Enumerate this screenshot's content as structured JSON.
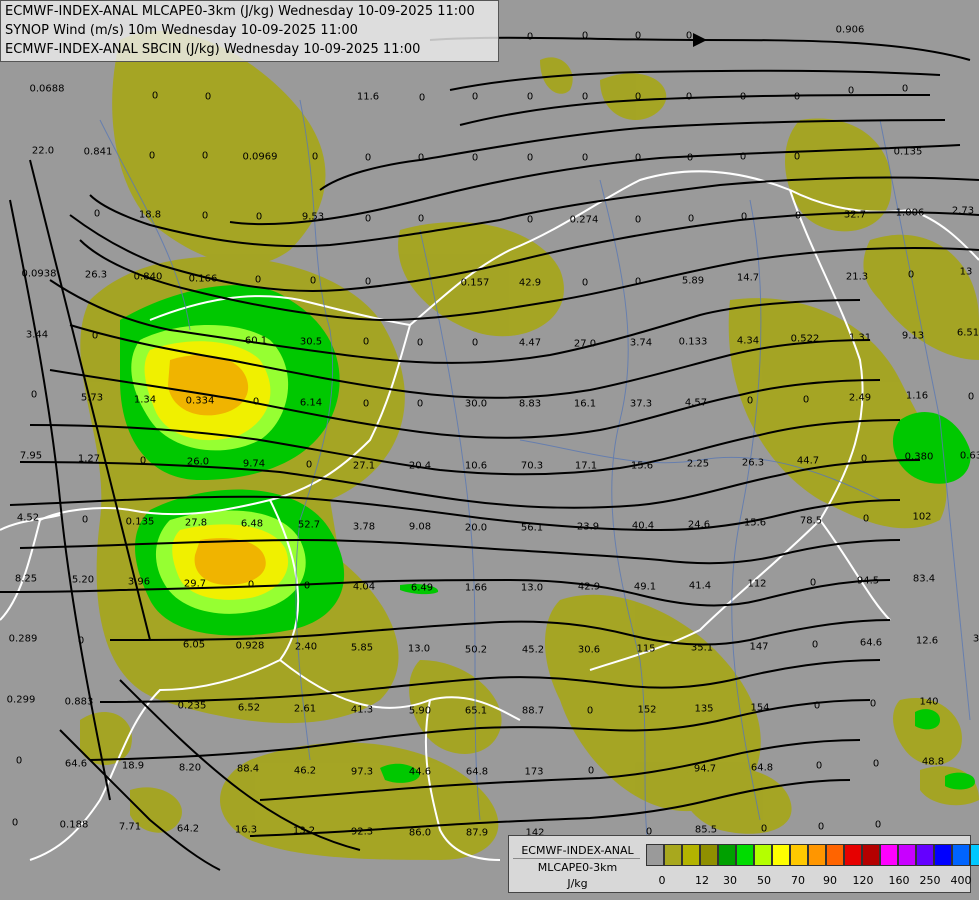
{
  "title_lines": [
    "ECMWF-INDEX-ANAL MLCAPE0-3km (J/kg) Wednesday 10-09-2025 11:00",
    "SYNOP Wind (m/s) 10m Wednesday 10-09-2025 11:00",
    "ECMWF-INDEX-ANAL SBCIN (J/kg) Wednesday 10-09-2025 11:00"
  ],
  "legend": {
    "name": "ECMWF-INDEX-ANAL",
    "sub": "MLCAPE0-3km",
    "unit": "J/kg",
    "colors": [
      "#9a9a9a",
      "#a8a81e",
      "#b3b300",
      "#8f8f00",
      "#00a000",
      "#00dc00",
      "#b4ff00",
      "#ffff00",
      "#ffc800",
      "#ff9600",
      "#ff6400",
      "#e60000",
      "#b40000",
      "#ff00ff",
      "#c800ff",
      "#6400ff",
      "#0000ff",
      "#0064ff",
      "#00c8ff",
      "#64ffff",
      "#ffffff"
    ],
    "ticks": [
      "0",
      "12",
      "30",
      "50",
      "70",
      "90",
      "120",
      "160",
      "250",
      "400"
    ]
  },
  "cin_values": [
    {
      "v": "0.0688"
    },
    {
      "v": "0"
    },
    {
      "v": "0"
    },
    {
      "v": "11.6"
    },
    {
      "v": "0"
    },
    {
      "v": "0"
    },
    {
      "v": "0"
    },
    {
      "v": "0"
    },
    {
      "v": "0"
    },
    {
      "v": "0"
    },
    {
      "v": "0"
    },
    {
      "v": "0"
    },
    {
      "v": "0"
    },
    {
      "v": "0"
    },
    {
      "v": "22.0"
    },
    {
      "v": "0.841"
    },
    {
      "v": "0"
    },
    {
      "v": "0"
    },
    {
      "v": "0.0969"
    },
    {
      "v": "0"
    },
    {
      "v": "0"
    },
    {
      "v": "0"
    },
    {
      "v": "0"
    },
    {
      "v": "0"
    },
    {
      "v": "0"
    },
    {
      "v": "0"
    },
    {
      "v": "0"
    },
    {
      "v": "0"
    },
    {
      "v": "0"
    },
    {
      "v": "0.135"
    },
    {
      "v": "0"
    },
    {
      "v": "18.8"
    },
    {
      "v": "0"
    },
    {
      "v": "0"
    },
    {
      "v": "9.53"
    },
    {
      "v": "0"
    },
    {
      "v": "0"
    },
    {
      "v": "0"
    },
    {
      "v": "0.274"
    },
    {
      "v": "0"
    },
    {
      "v": "0"
    },
    {
      "v": "0"
    },
    {
      "v": "0"
    },
    {
      "v": "32.7"
    },
    {
      "v": "1.006"
    },
    {
      "v": "2.73"
    },
    {
      "v": "0.0938"
    },
    {
      "v": "26.3"
    },
    {
      "v": "0.840"
    },
    {
      "v": "0.166"
    },
    {
      "v": "0"
    },
    {
      "v": "0"
    },
    {
      "v": "0"
    },
    {
      "v": "0.157"
    },
    {
      "v": "42.9"
    },
    {
      "v": "0"
    },
    {
      "v": "0"
    },
    {
      "v": "5.89"
    },
    {
      "v": "14.7"
    },
    {
      "v": "21.3"
    },
    {
      "v": "0"
    },
    {
      "v": "13"
    },
    {
      "v": "3.44"
    },
    {
      "v": "0"
    },
    {
      "v": "60.1"
    },
    {
      "v": "30.5"
    },
    {
      "v": "0"
    },
    {
      "v": "0"
    },
    {
      "v": "0"
    },
    {
      "v": "4.47"
    },
    {
      "v": "27.0"
    },
    {
      "v": "3.74"
    },
    {
      "v": "0.133"
    },
    {
      "v": "4.34"
    },
    {
      "v": "0.522"
    },
    {
      "v": "1.31"
    },
    {
      "v": "9.13"
    },
    {
      "v": "6.51"
    },
    {
      "v": "0"
    },
    {
      "v": "5.73"
    },
    {
      "v": "1.34"
    },
    {
      "v": "0.334"
    },
    {
      "v": "0"
    },
    {
      "v": "6.14"
    },
    {
      "v": "0"
    },
    {
      "v": "0"
    },
    {
      "v": "30.0"
    },
    {
      "v": "8.83"
    },
    {
      "v": "16.1"
    },
    {
      "v": "37.3"
    },
    {
      "v": "4.57"
    },
    {
      "v": "0"
    },
    {
      "v": "0"
    },
    {
      "v": "2.49"
    },
    {
      "v": "1.16"
    },
    {
      "v": "0"
    },
    {
      "v": "7.95"
    },
    {
      "v": "1.27"
    },
    {
      "v": "0"
    },
    {
      "v": "26.0"
    },
    {
      "v": "9.74"
    },
    {
      "v": "0"
    },
    {
      "v": "27.1"
    },
    {
      "v": "20.4"
    },
    {
      "v": "10.6"
    },
    {
      "v": "70.3"
    },
    {
      "v": "17.1"
    },
    {
      "v": "15.6"
    },
    {
      "v": "2.25"
    },
    {
      "v": "26.3"
    },
    {
      "v": "44.7"
    },
    {
      "v": "0"
    },
    {
      "v": "0.380"
    },
    {
      "v": "0.63"
    },
    {
      "v": "4.52"
    },
    {
      "v": "0"
    },
    {
      "v": "0.135"
    },
    {
      "v": "27.8"
    },
    {
      "v": "6.48"
    },
    {
      "v": "52.7"
    },
    {
      "v": "3.78"
    },
    {
      "v": "9.08"
    },
    {
      "v": "20.0"
    },
    {
      "v": "56.1"
    },
    {
      "v": "23.9"
    },
    {
      "v": "40.4"
    },
    {
      "v": "24.6"
    },
    {
      "v": "15.6"
    },
    {
      "v": "78.5"
    },
    {
      "v": "0"
    },
    {
      "v": "102"
    },
    {
      "v": "8.25"
    },
    {
      "v": "5.20"
    },
    {
      "v": "3.96"
    },
    {
      "v": "29.7"
    },
    {
      "v": "0"
    },
    {
      "v": "0"
    },
    {
      "v": "4.04"
    },
    {
      "v": "6.49"
    },
    {
      "v": "1.66"
    },
    {
      "v": "13.0"
    },
    {
      "v": "42.9"
    },
    {
      "v": "49.1"
    },
    {
      "v": "41.4"
    },
    {
      "v": "112"
    },
    {
      "v": "0"
    },
    {
      "v": "94.5"
    },
    {
      "v": "83.4"
    },
    {
      "v": "0.289"
    },
    {
      "v": "0"
    },
    {
      "v": "6.05"
    },
    {
      "v": "0.928"
    },
    {
      "v": "2.40"
    },
    {
      "v": "5.85"
    },
    {
      "v": "13.0"
    },
    {
      "v": "50.2"
    },
    {
      "v": "45.2"
    },
    {
      "v": "30.6"
    },
    {
      "v": "115"
    },
    {
      "v": "35.1"
    },
    {
      "v": "147"
    },
    {
      "v": "0"
    },
    {
      "v": "64.6"
    },
    {
      "v": "12.6"
    },
    {
      "v": "3"
    },
    {
      "v": "0.299"
    },
    {
      "v": "0.883"
    },
    {
      "v": "0.235"
    },
    {
      "v": "6.52"
    },
    {
      "v": "2.61"
    },
    {
      "v": "41.3"
    },
    {
      "v": "5.90"
    },
    {
      "v": "65.1"
    },
    {
      "v": "88.7"
    },
    {
      "v": "0"
    },
    {
      "v": "152"
    },
    {
      "v": "135"
    },
    {
      "v": "154"
    },
    {
      "v": "0"
    },
    {
      "v": "0"
    },
    {
      "v": "140"
    },
    {
      "v": "0"
    },
    {
      "v": "64.6"
    },
    {
      "v": "18.9"
    },
    {
      "v": "8.20"
    },
    {
      "v": "88.4"
    },
    {
      "v": "46.2"
    },
    {
      "v": "97.3"
    },
    {
      "v": "44.6"
    },
    {
      "v": "64.8"
    },
    {
      "v": "173"
    },
    {
      "v": "0"
    },
    {
      "v": "94.7"
    },
    {
      "v": "64.8"
    },
    {
      "v": "0"
    },
    {
      "v": "0"
    },
    {
      "v": "48.8"
    },
    {
      "v": "0"
    },
    {
      "v": "0.188"
    },
    {
      "v": "7.71"
    },
    {
      "v": "64.2"
    },
    {
      "v": "16.3"
    },
    {
      "v": "13.2"
    },
    {
      "v": "92.3"
    },
    {
      "v": "86.0"
    },
    {
      "v": "87.9"
    },
    {
      "v": "142"
    },
    {
      "v": "0"
    },
    {
      "v": "85.5"
    },
    {
      "v": "0"
    },
    {
      "v": "0"
    },
    {
      "v": "0"
    },
    {
      "v": "0.906"
    },
    {
      "v": "0"
    },
    {
      "v": "0"
    },
    {
      "v": "0"
    },
    {
      "v": "0"
    }
  ]
}
